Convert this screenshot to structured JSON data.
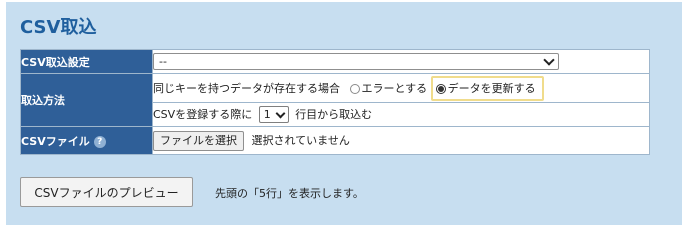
{
  "page_title": "CSV取込",
  "settings": {
    "rows": {
      "setting": {
        "label": "CSV取込設定",
        "select_value": "--"
      },
      "method": {
        "label": "取込方法",
        "duplicate_key_text": "同じキーを持つデータが存在する場合",
        "option_error": "エラーとする",
        "option_update": "データを更新する",
        "selected_option": "データを更新する",
        "register_prefix": "CSVを登録する際に",
        "start_row_value": "1",
        "register_suffix": "行目から取込む"
      },
      "file": {
        "label": "CSVファイル",
        "help_icon_glyph": "?",
        "choose_button": "ファイルを選択",
        "status_text": "選択されていません"
      }
    }
  },
  "preview": {
    "button_label": "CSVファイルのプレビュー",
    "note": "先頭の「5行」を表示します。"
  },
  "colors": {
    "panel_bg": "#c7def0",
    "title": "#1f5f9e",
    "label_bg": "#2f5f98",
    "highlight_border": "#f0dc8c"
  },
  "icons": [
    "chevron-down-icon",
    "help-icon",
    "radio-icon"
  ]
}
